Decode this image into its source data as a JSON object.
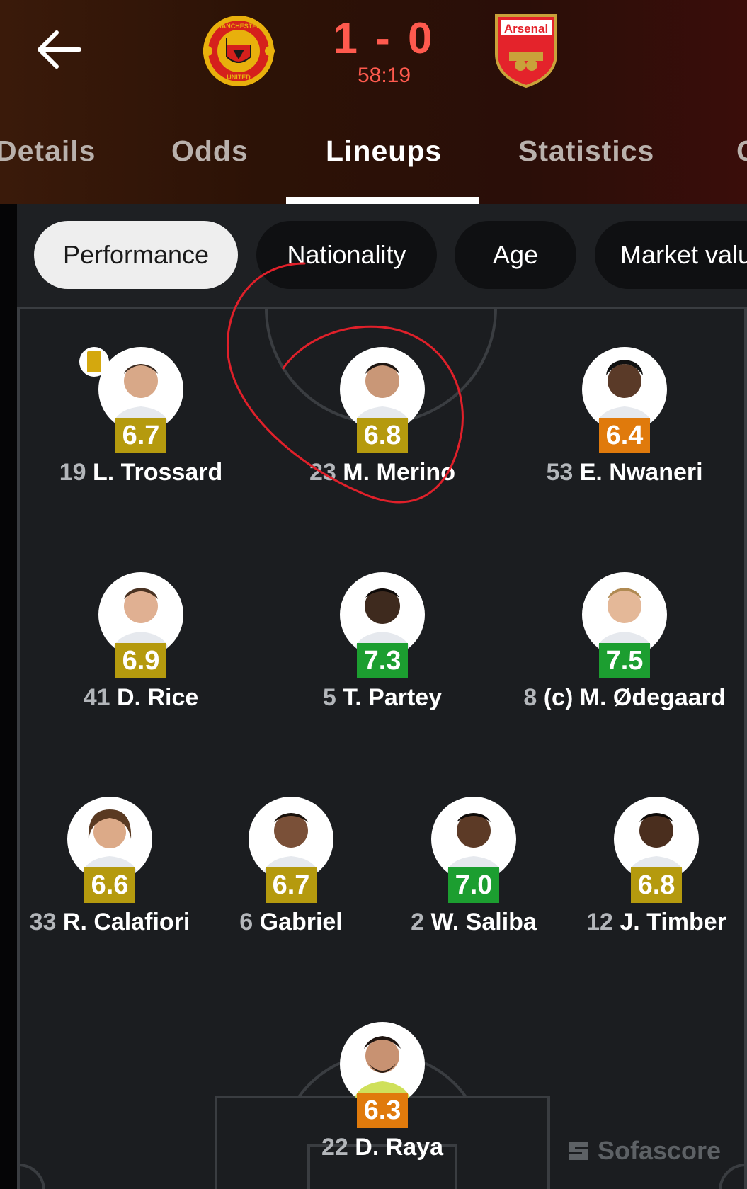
{
  "match": {
    "score": "1 - 0",
    "clock": "58:19",
    "home_team": "Manchester United",
    "away_team": "Arsenal",
    "home_crest_text_top": "MANCHESTER",
    "home_crest_text_bottom": "UNITED",
    "away_crest_text": "Arsenal"
  },
  "tabs": [
    "Details",
    "Odds",
    "Lineups",
    "Statistics",
    "C"
  ],
  "active_tab": "Lineups",
  "filters": [
    "Performance",
    "Nationality",
    "Age",
    "Market valu"
  ],
  "selected_filter": "Performance",
  "players": [
    {
      "number": "19",
      "name": "L. Trossard",
      "rating": "6.7",
      "rating_color": "#b59a0e",
      "yellow_card": true
    },
    {
      "number": "23",
      "name": "M. Merino",
      "rating": "6.8",
      "rating_color": "#b59a0e"
    },
    {
      "number": "53",
      "name": "E. Nwaneri",
      "rating": "6.4",
      "rating_color": "#e07a0c"
    },
    {
      "number": "41",
      "name": "D. Rice",
      "rating": "6.9",
      "rating_color": "#b59a0e"
    },
    {
      "number": "5",
      "name": "T. Partey",
      "rating": "7.3",
      "rating_color": "#1c9e30"
    },
    {
      "number": "8",
      "name": "(c) M. Ødegaard",
      "rating": "7.5",
      "rating_color": "#1c9e30"
    },
    {
      "number": "33",
      "name": "R. Calafiori",
      "rating": "6.6",
      "rating_color": "#b59a0e"
    },
    {
      "number": "6",
      "name": "Gabriel",
      "rating": "6.7",
      "rating_color": "#b59a0e"
    },
    {
      "number": "2",
      "name": "W. Saliba",
      "rating": "7.0",
      "rating_color": "#1c9e30"
    },
    {
      "number": "12",
      "name": "J. Timber",
      "rating": "6.8",
      "rating_color": "#b59a0e"
    },
    {
      "number": "22",
      "name": "D. Raya",
      "rating": "6.3",
      "rating_color": "#e07a0c"
    }
  ],
  "watermark": "Sofascore",
  "colors": {
    "score": "#ff5a4e",
    "annotation": "#e0202a"
  }
}
